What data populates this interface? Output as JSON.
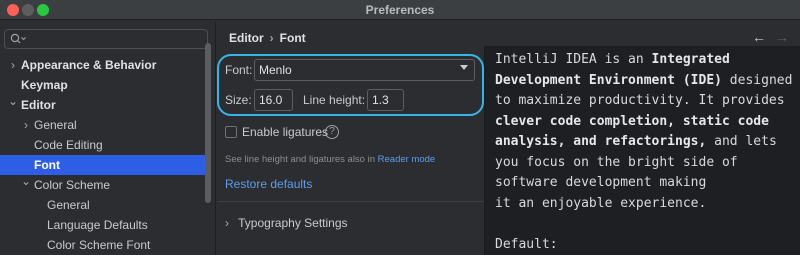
{
  "window": {
    "title": "Preferences"
  },
  "sidebar": {
    "search_placeholder": "",
    "items": [
      {
        "label": "Appearance & Behavior",
        "chevron": "›",
        "bold": true,
        "level": 0
      },
      {
        "label": "Keymap",
        "chevron": "",
        "bold": true,
        "level": 0
      },
      {
        "label": "Editor",
        "chevron": "⌄",
        "bold": true,
        "level": 0
      },
      {
        "label": "General",
        "chevron": "›",
        "bold": false,
        "level": 1
      },
      {
        "label": "Code Editing",
        "chevron": "",
        "bold": false,
        "level": 1
      },
      {
        "label": "Font",
        "chevron": "",
        "bold": false,
        "level": 1,
        "selected": true
      },
      {
        "label": "Color Scheme",
        "chevron": "⌄",
        "bold": false,
        "level": 1
      },
      {
        "label": "General",
        "chevron": "",
        "bold": false,
        "level": 2
      },
      {
        "label": "Language Defaults",
        "chevron": "",
        "bold": false,
        "level": 2
      },
      {
        "label": "Color Scheme Font",
        "chevron": "",
        "bold": false,
        "level": 2
      }
    ]
  },
  "breadcrumb": {
    "parent": "Editor",
    "separator": "›",
    "current": "Font"
  },
  "nav": {
    "back": "←",
    "forward": "→"
  },
  "font_settings": {
    "font_label": "Font:",
    "font_value": "Menlo",
    "size_label": "Size:",
    "size_value": "16.0",
    "line_height_label": "Line height:",
    "line_height_value": "1.3",
    "ligatures_label": "Enable ligatures",
    "ligatures_checked": false,
    "help_glyph": "?",
    "note_text": "See line height and ligatures also in ",
    "note_link": "Reader mode",
    "restore_defaults": "Restore defaults",
    "typography_chevron": "›",
    "typography_label": "Typography Settings"
  },
  "preview": {
    "lines": [
      [
        {
          "t": "IntelliJ IDEA is an "
        },
        {
          "t": "Integrated",
          "b": true
        }
      ],
      [
        {
          "t": "Development Environment (IDE)",
          "b": true
        },
        {
          "t": " designed"
        }
      ],
      [
        {
          "t": "to maximize productivity. It provides"
        }
      ],
      [
        {
          "t": "clever code completion, static code",
          "b": true
        }
      ],
      [
        {
          "t": "analysis, and refactorings,",
          "b": true
        },
        {
          "t": " and lets"
        }
      ],
      [
        {
          "t": "you focus on the bright side of"
        }
      ],
      [
        {
          "t": "software development making"
        }
      ],
      [
        {
          "t": "it an enjoyable experience."
        }
      ],
      [
        {
          "t": ""
        }
      ],
      [
        {
          "t": "Default:"
        }
      ]
    ]
  },
  "colors": {
    "accent_highlight": "#34b7e8",
    "selection": "#2e5ee6",
    "link": "#5c9ded"
  }
}
